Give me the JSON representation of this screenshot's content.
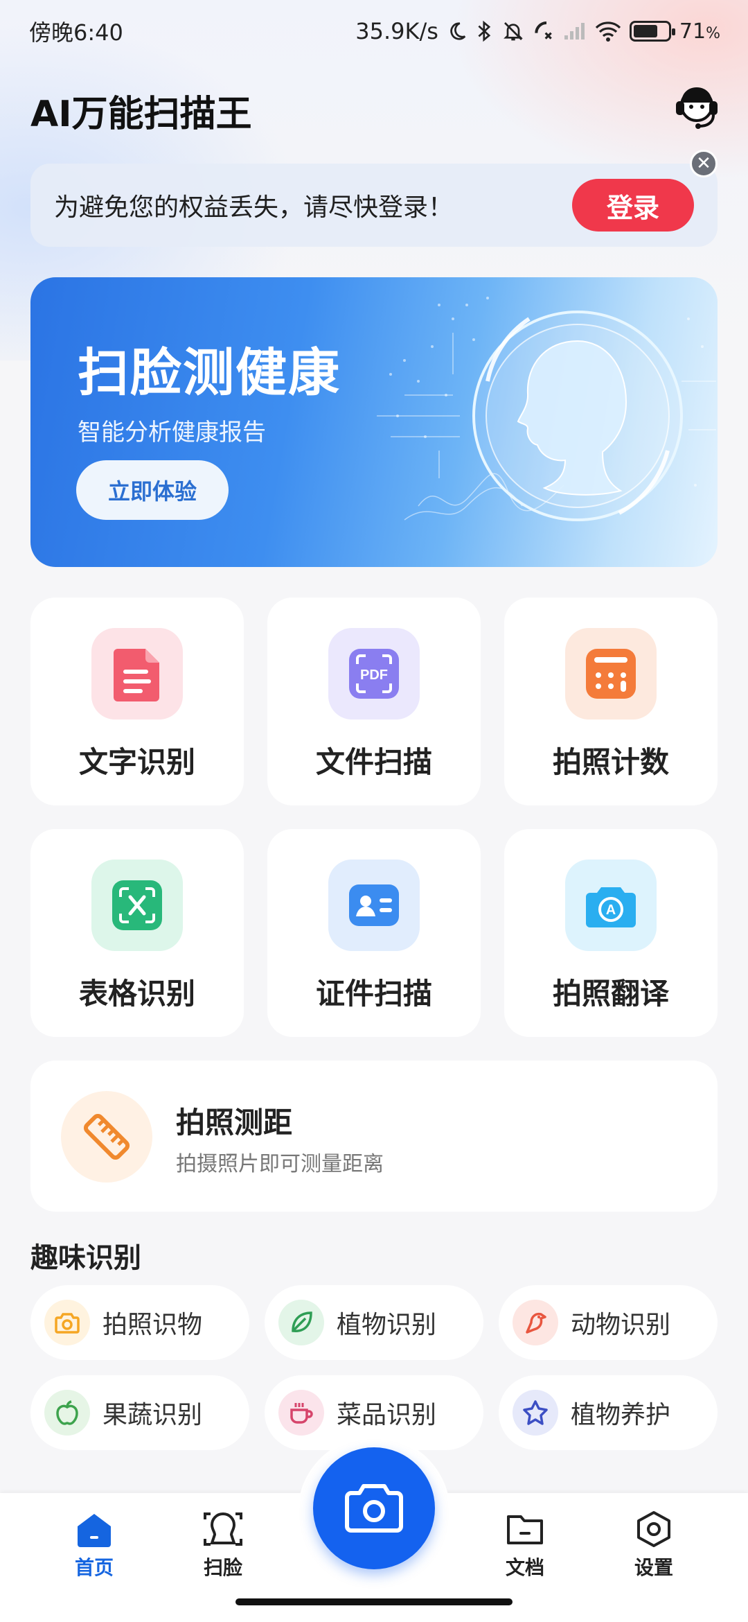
{
  "status_bar": {
    "time": "傍晚6:40",
    "network_speed": "35.9K/s",
    "battery_percent": "71",
    "battery_unit": "%",
    "battery_level": 0.71
  },
  "header": {
    "title": "AI万能扫描王",
    "support_icon": "customer-service-icon"
  },
  "login_banner": {
    "text": "为避免您的权益丢失，请尽快登录！",
    "button_label": "登录",
    "close_icon": "close-icon"
  },
  "hero": {
    "title": "扫脸测健康",
    "subtitle": "智能分析健康报告",
    "button_label": "立即体验"
  },
  "tools": [
    {
      "label": "文字识别",
      "icon": "document-text-icon",
      "color": "#f25c6e",
      "bg": "#fde3e7"
    },
    {
      "label": "文件扫描",
      "icon": "pdf-scan-icon",
      "color": "#8a7ef0",
      "bg": "#ebe8fd"
    },
    {
      "label": "拍照计数",
      "icon": "calculator-icon",
      "color": "#f47b3a",
      "bg": "#fde9de"
    },
    {
      "label": "表格识别",
      "icon": "excel-icon",
      "color": "#28b87a",
      "bg": "#ddf6ea"
    },
    {
      "label": "证件扫描",
      "icon": "id-card-icon",
      "color": "#3b8cf0",
      "bg": "#e1edfd"
    },
    {
      "label": "拍照翻译",
      "icon": "camera-translate-icon",
      "color": "#2aaef0",
      "bg": "#ddf3fd"
    }
  ],
  "distance": {
    "title": "拍照测距",
    "subtitle": "拍摄照片即可测量距离",
    "icon": "ruler-icon"
  },
  "fun_section": {
    "title": "趣味识别",
    "items": [
      {
        "label": "拍照识物",
        "icon": "camera-icon",
        "color": "#f5a623",
        "bg": "#fff3df"
      },
      {
        "label": "植物识别",
        "icon": "leaf-icon",
        "color": "#2f9e55",
        "bg": "#e3f5e8"
      },
      {
        "label": "动物识别",
        "icon": "bird-icon",
        "color": "#e8563f",
        "bg": "#fde6e2"
      },
      {
        "label": "果蔬识别",
        "icon": "apple-icon",
        "color": "#3da34d",
        "bg": "#e6f5e6"
      },
      {
        "label": "菜品识别",
        "icon": "cup-icon",
        "color": "#d6456b",
        "bg": "#fbe4eb"
      },
      {
        "label": "植物养护",
        "icon": "star-icon",
        "color": "#3c4fc4",
        "bg": "#e6e9fa"
      }
    ]
  },
  "bottom_nav": {
    "items": [
      {
        "label": "首页",
        "icon": "home-icon",
        "active": true
      },
      {
        "label": "扫脸",
        "icon": "face-scan-icon",
        "active": false
      },
      {
        "label": "文档",
        "icon": "folder-icon",
        "active": false
      },
      {
        "label": "设置",
        "icon": "settings-icon",
        "active": false
      }
    ],
    "center_icon": "camera-icon"
  },
  "colors": {
    "accent_blue": "#1462ef",
    "login_red": "#f0384b"
  }
}
